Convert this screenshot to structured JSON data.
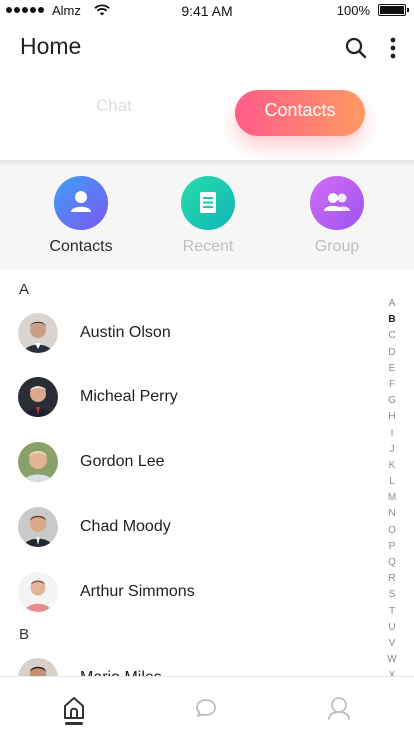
{
  "status_bar": {
    "carrier": "Almz",
    "time": "9:41 AM",
    "battery": "100%"
  },
  "header": {
    "title": "Home"
  },
  "tabs": [
    {
      "label": "Chat",
      "active": false
    },
    {
      "label": "Contacts",
      "active": true
    }
  ],
  "categories": [
    {
      "label": "Contacts",
      "icon": "person-icon",
      "active": true
    },
    {
      "label": "Recent",
      "icon": "document-icon",
      "active": false
    },
    {
      "label": "Group",
      "icon": "group-icon",
      "active": false
    }
  ],
  "sections": [
    {
      "letter": "A",
      "contacts": [
        "Austin Olson",
        "Micheal Perry",
        "Gordon Lee",
        "Chad Moody",
        "Arthur Simmons"
      ]
    },
    {
      "letter": "B",
      "contacts": [
        "Mario Miles"
      ]
    }
  ],
  "alphabet": [
    "A",
    "B",
    "C",
    "D",
    "E",
    "F",
    "G",
    "H",
    "I",
    "J",
    "K",
    "L",
    "M",
    "N",
    "O",
    "P",
    "Q",
    "R",
    "S",
    "T",
    "U",
    "V",
    "W",
    "X"
  ],
  "alphabet_active": "B",
  "bottom_nav": [
    {
      "icon": "home-icon",
      "active": true
    },
    {
      "icon": "chat-bubble-icon",
      "active": false
    },
    {
      "icon": "profile-icon",
      "active": false
    }
  ],
  "colors": {
    "accent_gradient_start": "#ff5c8a",
    "accent_gradient_end": "#ff9a62",
    "contacts_icon": "#5a7cf4",
    "recent_icon": "#1fc8b0",
    "group_icon": "#b060f2"
  }
}
